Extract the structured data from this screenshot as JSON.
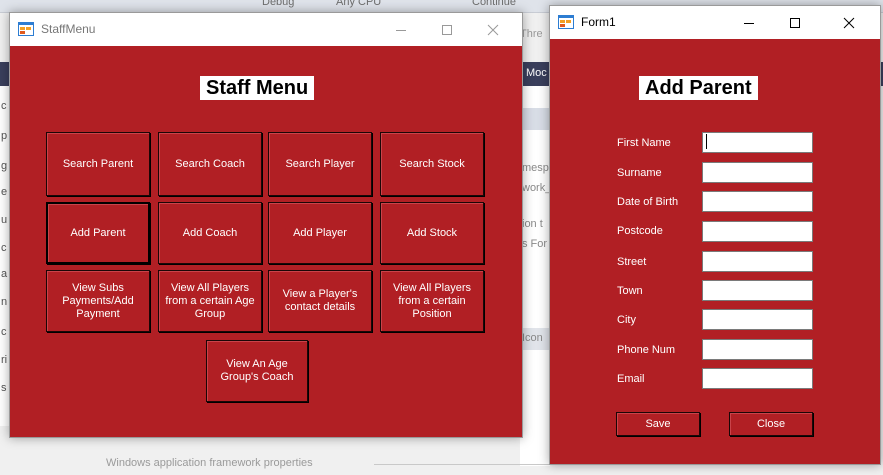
{
  "background": {
    "top_fragments": [
      "Debug",
      "Any CPU",
      "Continue"
    ],
    "bar_items": [
      "Moc",
      "Thre"
    ],
    "left_letters": [
      "c",
      "p",
      "g",
      "e",
      "u",
      "c",
      "a",
      "n",
      "c",
      "ri",
      "s"
    ],
    "panel_fragments": [
      "mesp",
      "work_",
      "ion t",
      "s For",
      "Icon"
    ],
    "footer_text": "Windows application framework properties"
  },
  "staff_window": {
    "title": "StaffMenu",
    "heading": "Staff Menu",
    "buttons": [
      [
        "Search Parent",
        "Search Coach",
        "Search Player",
        "Search Stock"
      ],
      [
        "Add Parent",
        "Add Coach",
        "Add Player",
        "Add Stock"
      ],
      [
        "View Subs Payments/Add Payment",
        "View All Players from a certain Age Group",
        "View a Player's contact details",
        "View All Players from a certain Position"
      ]
    ],
    "bottom_button": "View An Age Group's Coach"
  },
  "parent_window": {
    "title": "Form1",
    "heading": "Add Parent",
    "fields": [
      {
        "label": "First Name",
        "value": ""
      },
      {
        "label": "Surname",
        "value": ""
      },
      {
        "label": "Date of Birth",
        "value": ""
      },
      {
        "label": "Postcode",
        "value": ""
      },
      {
        "label": "Street",
        "value": ""
      },
      {
        "label": "Town",
        "value": ""
      },
      {
        "label": "City",
        "value": ""
      },
      {
        "label": "Phone Num",
        "value": ""
      },
      {
        "label": "Email",
        "value": ""
      }
    ],
    "save_label": "Save",
    "close_label": "Close"
  },
  "colors": {
    "form_background": "#b11f24",
    "text": "#ffffff"
  },
  "icons": [
    "winform-app-icon",
    "minimize-icon",
    "maximize-icon",
    "close-icon"
  ]
}
